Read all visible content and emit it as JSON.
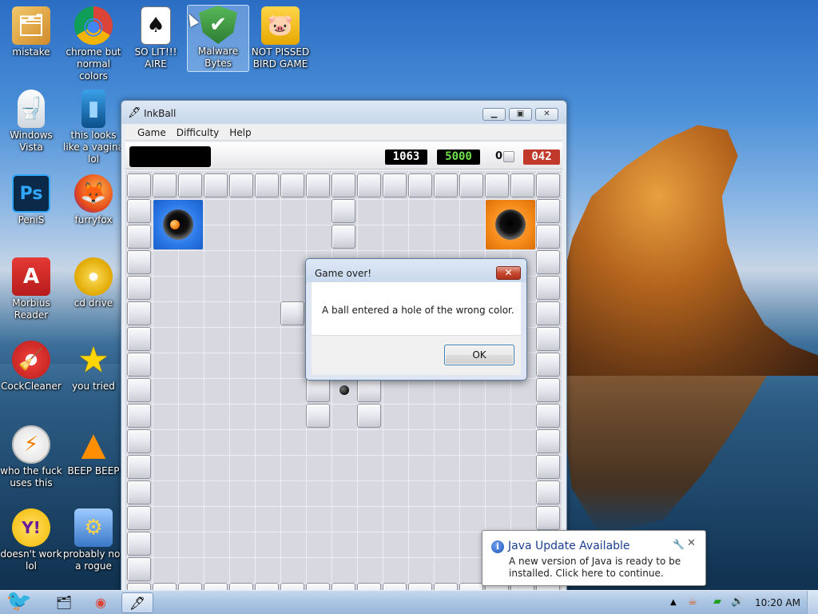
{
  "desktop": {
    "icons": [
      {
        "label": "mistake",
        "glyph": "🗂"
      },
      {
        "label": "chrome but normal colors",
        "glyph": "◉"
      },
      {
        "label": "SO LIT!!! AIRE",
        "glyph": "♠"
      },
      {
        "label": "Malware Bytes",
        "glyph": "✔"
      },
      {
        "label": "NOT PISSED BIRD GAME",
        "glyph": "🐷"
      },
      {
        "label": "Windows Vista",
        "glyph": "🚽"
      },
      {
        "label": "this looks like a vagina lol",
        "glyph": "▮"
      },
      {
        "label": "PeniS",
        "glyph": "Ps"
      },
      {
        "label": "furryfox",
        "glyph": "🦊"
      },
      {
        "label": "Morbius Reader",
        "glyph": "A"
      },
      {
        "label": "cd drive",
        "glyph": "◎"
      },
      {
        "label": "CockCleaner",
        "glyph": "🧹"
      },
      {
        "label": "you tried",
        "glyph": "★"
      },
      {
        "label": "who the fuck uses this",
        "glyph": "⚡"
      },
      {
        "label": "BEEP BEEP",
        "glyph": "▲"
      },
      {
        "label": "doesn't work lol",
        "glyph": "Y!"
      },
      {
        "label": "probably not a rogue",
        "glyph": "⚙"
      }
    ]
  },
  "inkball": {
    "title": "InkBall",
    "menu": [
      "Game",
      "Difficulty",
      "Help"
    ],
    "score_current": "1063",
    "score_target": "5000",
    "balls_left": "0",
    "timer": "042",
    "colors": {
      "blue_hole": "#2a78e8",
      "orange_hole": "#f58a18",
      "timer_bg": "#c0392b",
      "target_text": "#6ee24a"
    }
  },
  "dialog": {
    "title": "Game over!",
    "message": "A ball entered a hole of the wrong color.",
    "ok_label": "OK",
    "close_label": "✕"
  },
  "notification": {
    "title": "Java Update Available",
    "body": "A new version of Java is ready to be installed. Click here to continue."
  },
  "taskbar": {
    "clock": "10:20 AM"
  }
}
